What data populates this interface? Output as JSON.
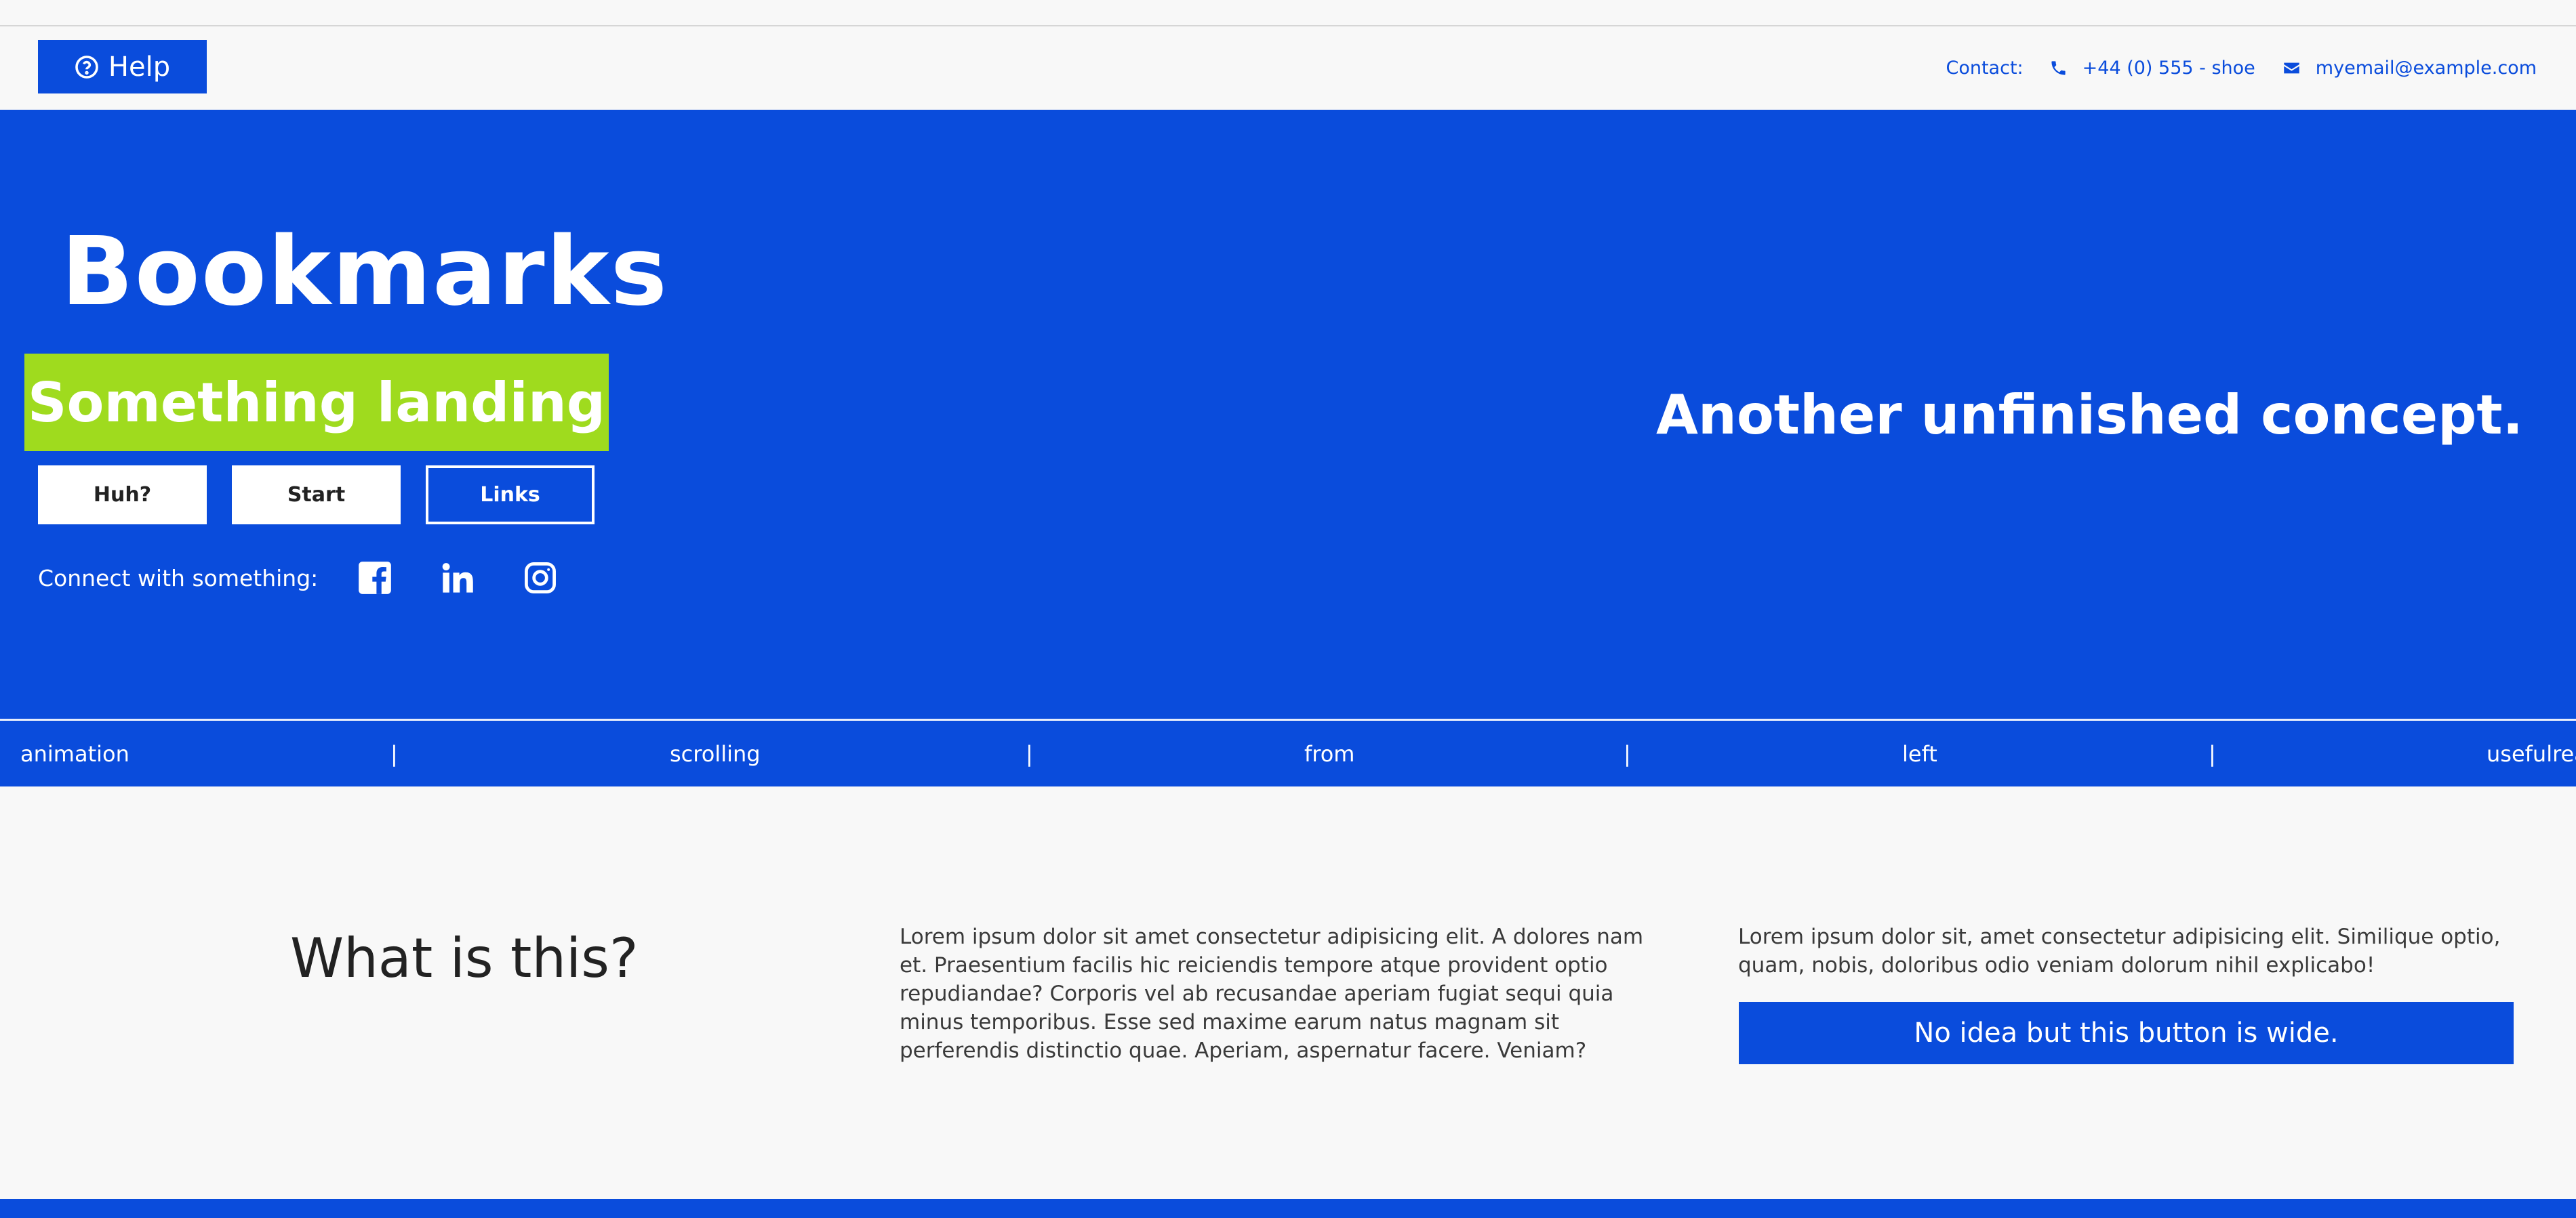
{
  "header": {
    "help_label": "Help",
    "contact_label": "Contact:",
    "phone": "+44 (0) 555 - shoe",
    "email": "myemail@example.com"
  },
  "hero": {
    "title": "Bookmarks",
    "subtitle": "Something landing",
    "buttons": [
      "Huh?",
      "Start",
      "Links"
    ],
    "social_label": "Connect with something:",
    "social_icons": [
      "facebook-icon",
      "linkedin-icon",
      "instagram-icon"
    ],
    "tagline": "Another unfinished concept."
  },
  "ticker": {
    "words": [
      "animation",
      "scrolling",
      "from",
      "left",
      "usefulrea"
    ],
    "separator": "|"
  },
  "about": {
    "title": "What is this?",
    "paragraph1": "Lorem ipsum dolor sit amet consectetur adipisicing elit. A dolores nam et. Praesentium facilis hic reiciendis tempore atque provident optio repudiandae? Corporis vel ab recusandae aperiam fugiat sequi quia minus temporibus. Esse sed maxime earum natus magnam sit perferendis distinctio quae. Aperiam, aspernatur facere. Veniam?",
    "paragraph2": "Lorem ipsum dolor sit, amet consectetur adipisicing elit. Similique optio, quam, nobis, doloribus odio veniam dolorum nihil explicabo!",
    "wide_button": "No idea but this button is wide."
  },
  "colors": {
    "primary": "#0a4cdc",
    "accent": "#9fdb1e",
    "background": "#f8f8f8"
  }
}
